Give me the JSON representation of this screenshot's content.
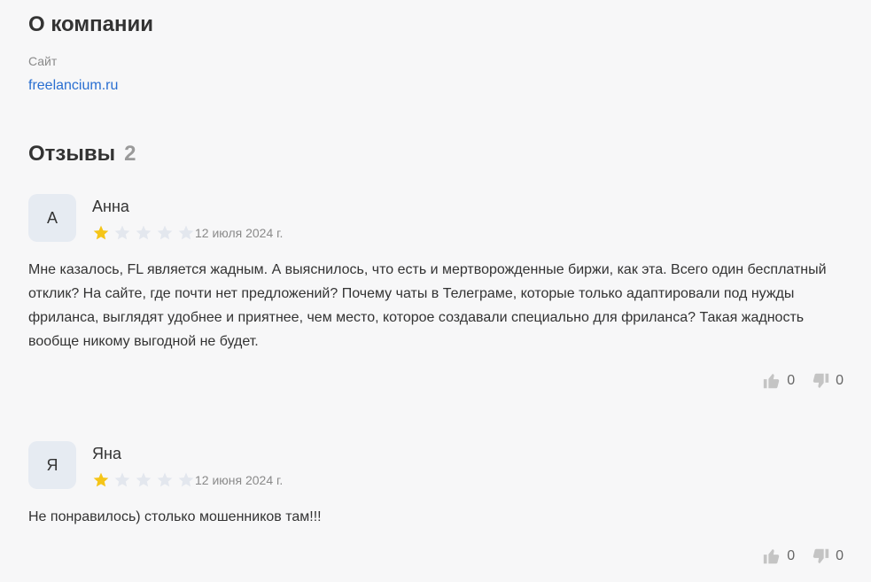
{
  "about": {
    "title": "О компании",
    "site_label": "Сайт",
    "site_link": "freelancium.ru"
  },
  "reviews_header": {
    "title": "Отзывы",
    "count": "2"
  },
  "reviews": [
    {
      "avatar_letter": "А",
      "author": "Анна",
      "rating": 1,
      "max_rating": 5,
      "date": "12 июля 2024 г.",
      "text": "Мне казалось, FL является жадным. А выяснилось, что есть и мертворожденные биржи, как эта. Всего один бесплатный отклик? На сайте, где почти нет предложений? Почему чаты в Телеграме, которые только адаптировали под нужды фриланса, выглядят удобнее и приятнее, чем место, которое создавали специально для фриланса? Такая жадность вообще никому выгодной не будет.",
      "likes": "0",
      "dislikes": "0"
    },
    {
      "avatar_letter": "Я",
      "author": "Яна",
      "rating": 1,
      "max_rating": 5,
      "date": "12 июня 2024 г.",
      "text": "Не понравилось) столько мошенников там!!!",
      "likes": "0",
      "dislikes": "0"
    }
  ],
  "colors": {
    "star_filled": "#f5c518",
    "star_empty": "#e3e7ee",
    "link": "#2a6fd1",
    "vote_icon": "#c4c4c4"
  },
  "icons": {
    "like": "thumbs-up-icon",
    "dislike": "thumbs-down-icon",
    "star": "star-icon"
  }
}
